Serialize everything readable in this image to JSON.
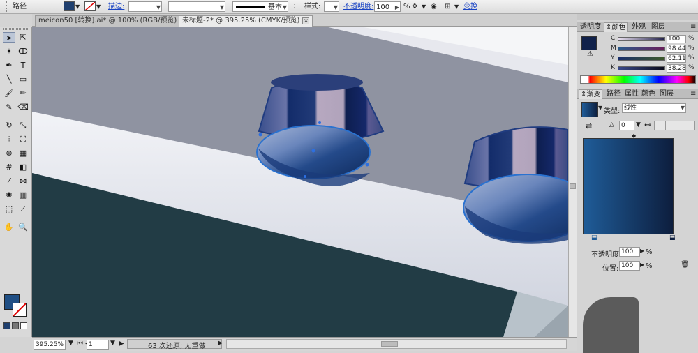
{
  "control_bar": {
    "object_type": "路径",
    "fill_color": "#1f3f6e",
    "stroke_label": "描边:",
    "stroke_style": "基本",
    "style_label": "样式:",
    "opacity_label": "不透明度:",
    "opacity_value": "100",
    "opacity_unit": "%",
    "transform_link": "变换"
  },
  "tabs": [
    {
      "label": "meicon50 [转换].ai* @ 100% (RGB/预览)",
      "active": false
    },
    {
      "label": "未标题-2* @ 395.25% (CMYK/预览)",
      "active": true
    }
  ],
  "toolbox": {
    "fill_color": "#1f4f85",
    "tools": [
      "selection-tool",
      "direct-selection-tool",
      "magic-wand-tool",
      "lasso-tool",
      "pen-tool",
      "type-tool",
      "line-tool",
      "rectangle-tool",
      "paintbrush-tool",
      "pencil-tool",
      "blob-brush-tool",
      "eraser-tool",
      "rotate-tool",
      "scale-tool",
      "width-tool",
      "free-transform-tool",
      "shape-builder-tool",
      "perspective-grid-tool",
      "mesh-tool",
      "gradient-tool",
      "eyedropper-tool",
      "blend-tool",
      "symbol-sprayer-tool",
      "column-graph-tool",
      "artboard-tool",
      "slice-tool",
      "hand-tool",
      "zoom-tool"
    ]
  },
  "status_bar": {
    "zoom": "395.25%",
    "artboard": "1",
    "history": "63 次还原; 无重做"
  },
  "color_panel": {
    "tabs": [
      "透明度",
      "颜色",
      "外观",
      "图层"
    ],
    "active_tab": "颜色",
    "swatch_color": "#10214a",
    "channels": [
      {
        "label": "C",
        "value": "100",
        "unit": "%"
      },
      {
        "label": "M",
        "value": "98.44",
        "unit": "%"
      },
      {
        "label": "Y",
        "value": "62.11",
        "unit": "%"
      },
      {
        "label": "K",
        "value": "38.28",
        "unit": "%"
      }
    ]
  },
  "gradient_panel": {
    "tabs": [
      "渐变",
      "路径",
      "属性",
      "颜色",
      "图层"
    ],
    "active_tab": "渐变",
    "type_label": "类型:",
    "type_value": "线性",
    "angle_value": "0",
    "opacity_label": "不透明度:",
    "opacity_value": "100",
    "location_label": "位置:",
    "location_value": "100",
    "unit": "%",
    "start_color": "#1f5c98",
    "end_color": "#0d1e3e"
  }
}
